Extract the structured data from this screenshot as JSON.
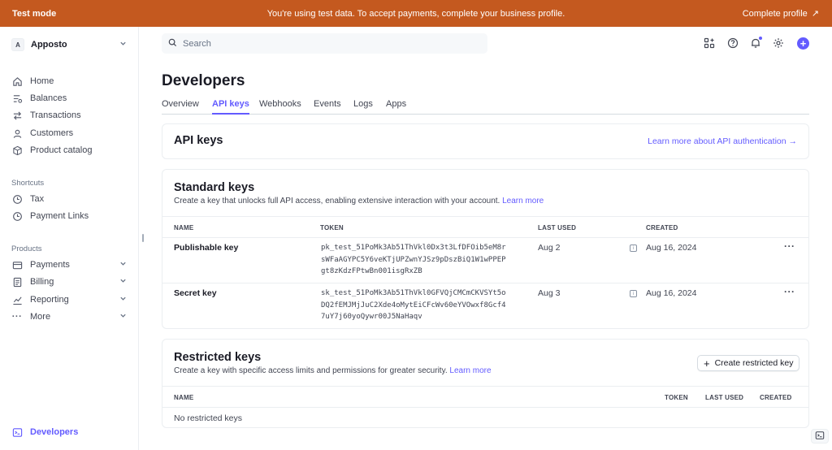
{
  "banner": {
    "mode_label": "Test mode",
    "message": "You're using test data. To accept payments, complete your business profile.",
    "cta_label": "Complete profile"
  },
  "sidebar": {
    "account": {
      "initial": "A",
      "name": "Apposto"
    },
    "main_items": [
      {
        "label": "Home",
        "icon": "home-icon"
      },
      {
        "label": "Balances",
        "icon": "balances-icon"
      },
      {
        "label": "Transactions",
        "icon": "transactions-icon"
      },
      {
        "label": "Customers",
        "icon": "customers-icon"
      },
      {
        "label": "Product catalog",
        "icon": "box-icon"
      }
    ],
    "shortcuts_label": "Shortcuts",
    "shortcuts": [
      {
        "label": "Tax",
        "icon": "tax-icon"
      },
      {
        "label": "Payment Links",
        "icon": "payment-links-icon"
      }
    ],
    "products_label": "Products",
    "products": [
      {
        "label": "Payments",
        "icon": "payments-icon"
      },
      {
        "label": "Billing",
        "icon": "billing-icon"
      },
      {
        "label": "Reporting",
        "icon": "reporting-icon"
      },
      {
        "label": "More",
        "icon": "ellipsis-icon"
      }
    ],
    "developers_label": "Developers"
  },
  "header": {
    "search_placeholder": "Search",
    "accent_color": "#635bff"
  },
  "page": {
    "title": "Developers",
    "tabs": [
      "Overview",
      "API keys",
      "Webhooks",
      "Events",
      "Logs",
      "Apps"
    ],
    "active_tab": "API keys"
  },
  "api_keys_card": {
    "title": "API keys",
    "link": "Learn more about API authentication →"
  },
  "standard_keys": {
    "title": "Standard keys",
    "subtitle": "Create a key that unlocks full API access, enabling extensive interaction with your account.",
    "learn_more": "Learn more",
    "columns": [
      "NAME",
      "TOKEN",
      "LAST USED",
      "CREATED"
    ],
    "rows": [
      {
        "name": "Publishable key",
        "token": "pk_test_51PoMk3Ab51ThVkl0Dx3t3LfDFOib5eM8r\nsWFaAGYPC5Y6veKTjUPZwnYJSz9pDszBiQ1W1wPPEP\ngt8zKdzFPtwBn001isgRxZB",
        "last_used": "Aug 2",
        "created": "Aug 16, 2024"
      },
      {
        "name": "Secret key",
        "token": "sk_test_51PoMk3Ab51ThVkl0GFVQjCMCmCKVSYt5o\nDQ2fEMJMjJuC2Xde4oMytEiCFcWv60eYVOwxf8Gcf4\n7uY7j60yoQywr00J5NaHaqv",
        "last_used": "Aug 3",
        "created": "Aug 16, 2024"
      }
    ]
  },
  "restricted_keys": {
    "title": "Restricted keys",
    "subtitle": "Create a key with specific access limits and permissions for greater security.",
    "learn_more": "Learn more",
    "create_button": "Create restricted key",
    "columns": [
      "NAME",
      "TOKEN",
      "LAST USED",
      "CREATED"
    ],
    "empty_text": "No restricted keys"
  }
}
